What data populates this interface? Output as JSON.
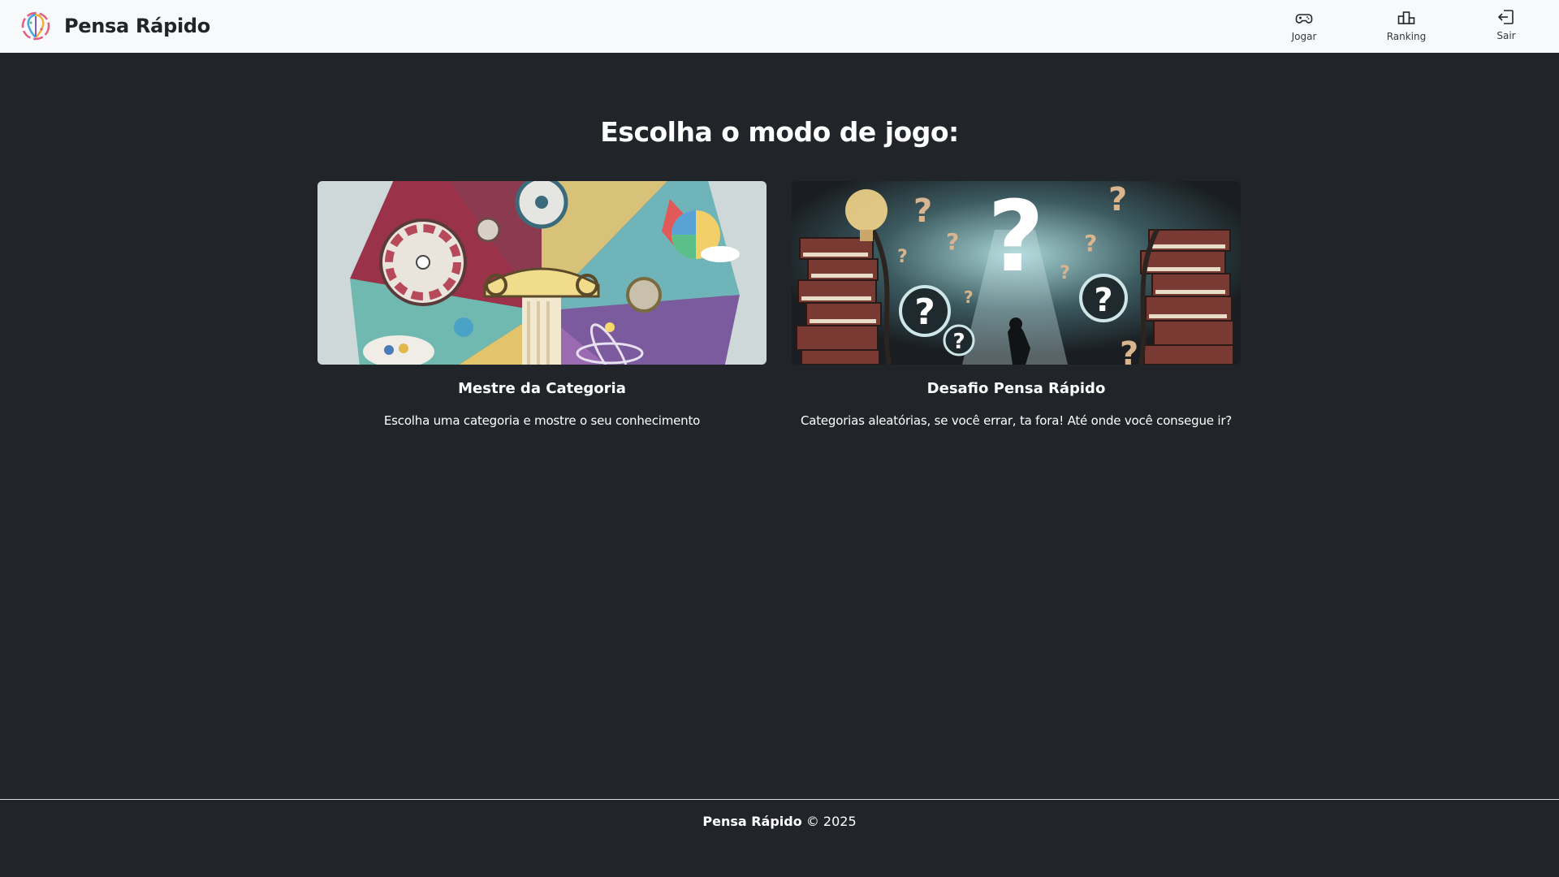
{
  "navbar": {
    "brand_name": "Pensa Rápido",
    "items": [
      {
        "label": "Jogar",
        "icon": "gamepad-icon"
      },
      {
        "label": "Ranking",
        "icon": "podium-icon"
      },
      {
        "label": "Sair",
        "icon": "logout-icon"
      }
    ]
  },
  "main": {
    "title": "Escolha o modo de jogo:",
    "modes": [
      {
        "title": "Mestre da Categoria",
        "description": "Escolha uma categoria e mostre o seu conhecimento"
      },
      {
        "title": "Desafio Pensa Rápido",
        "description": "Categorias aleatórias, se você errar, ta fora! Até onde você consegue ir?"
      }
    ]
  },
  "footer": {
    "brand": "Pensa Rápido",
    "copyright": " © 2025"
  },
  "colors": {
    "background": "#212529",
    "navbar": "#f8f9fa",
    "text": "#ffffff"
  }
}
